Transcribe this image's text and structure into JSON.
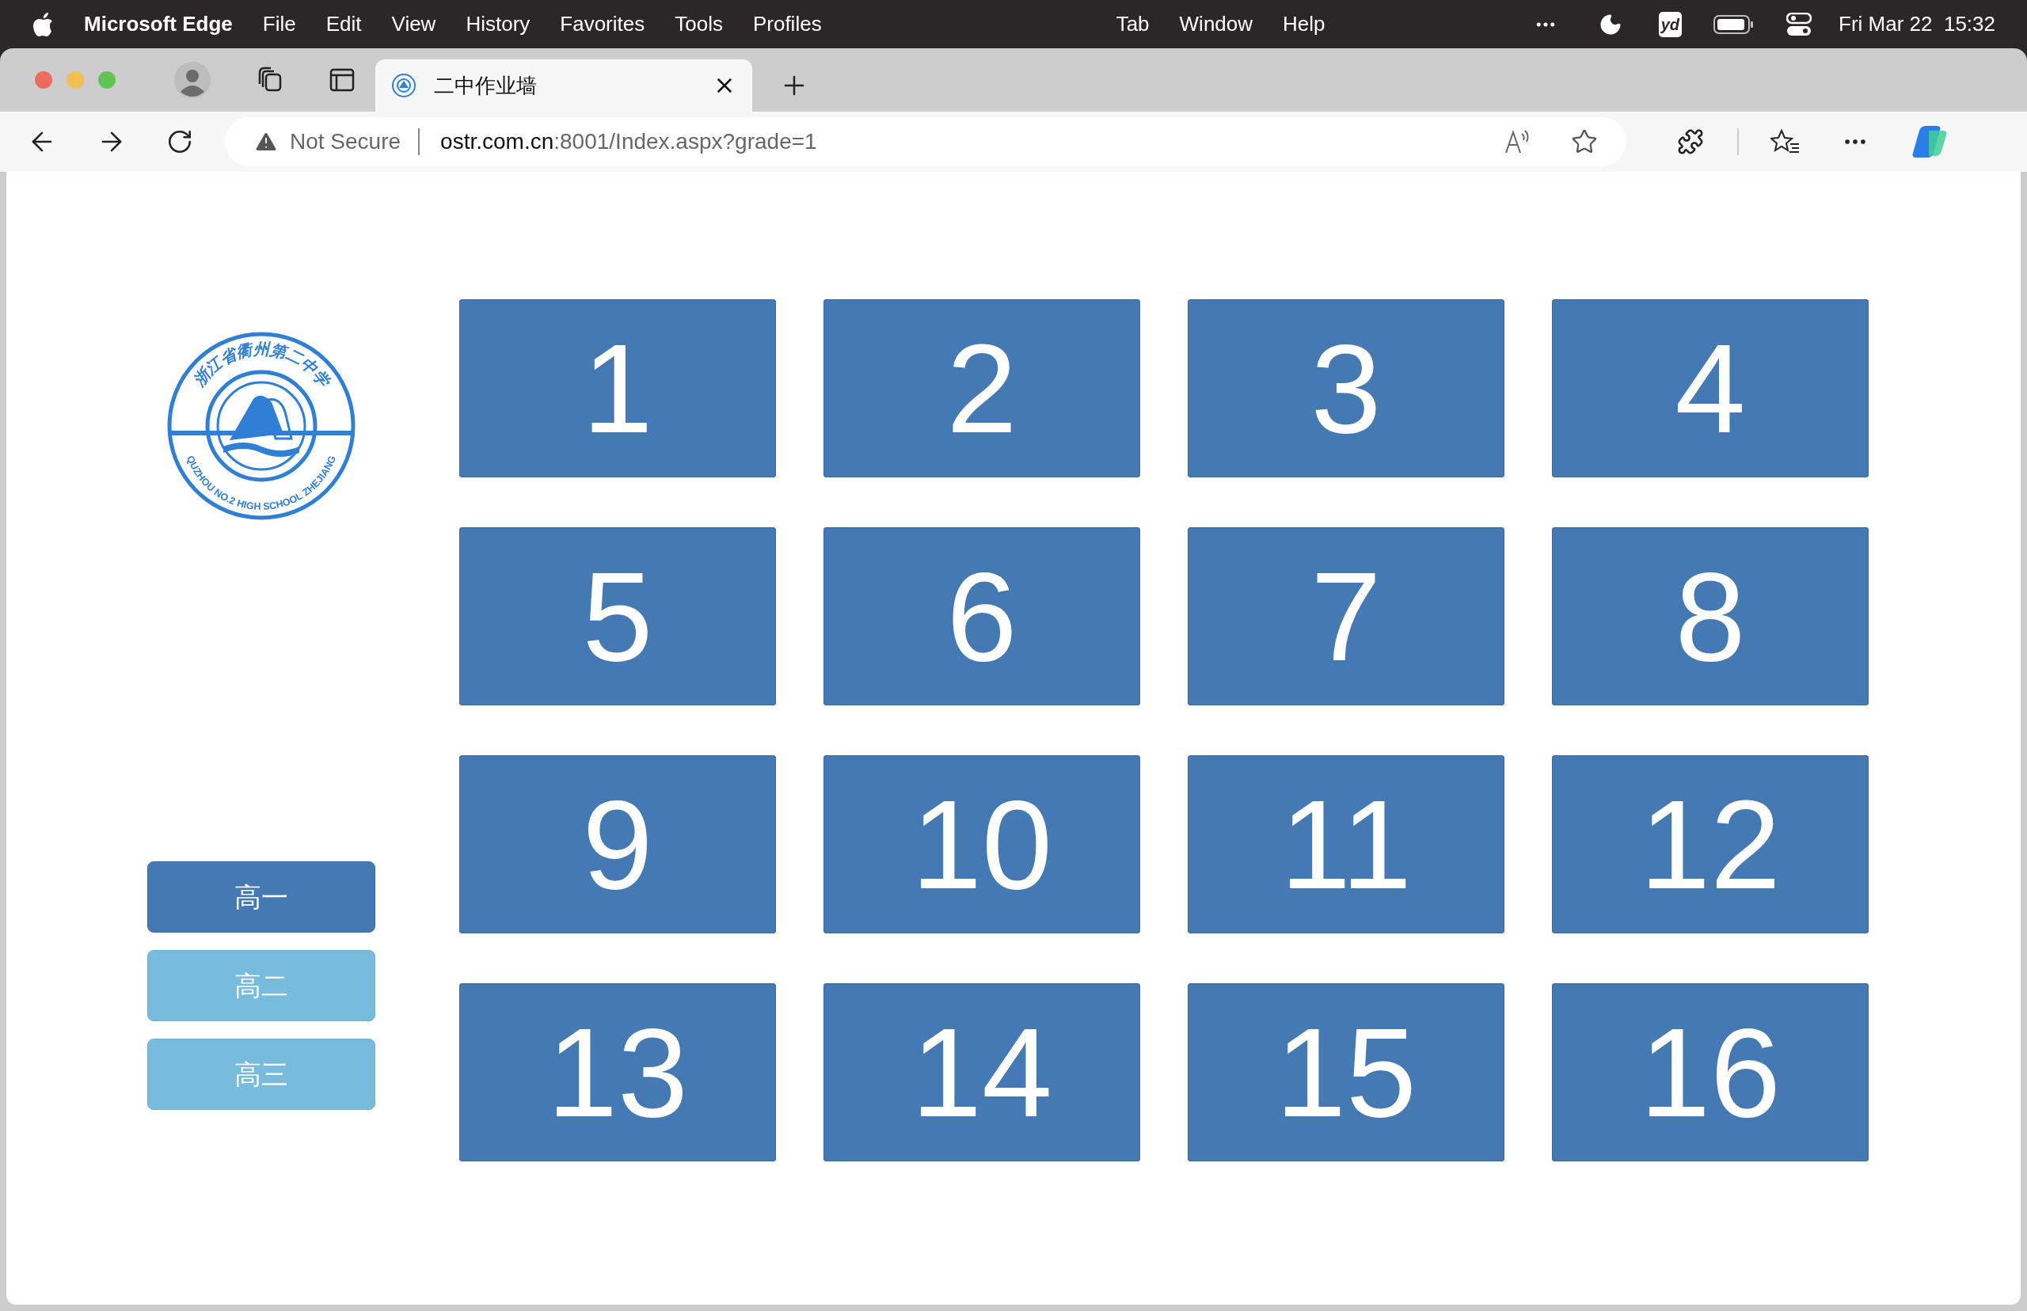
{
  "menu_bar": {
    "app": "Microsoft Edge",
    "menus": [
      "File",
      "Edit",
      "View",
      "History",
      "Favorites",
      "Tools",
      "Profiles",
      "Tab",
      "Window",
      "Help"
    ],
    "status_icon_text": "yd",
    "clock": "Fri Mar 22  15:32"
  },
  "tab": {
    "title": "二中作业墙"
  },
  "address_bar": {
    "security": "Not Secure",
    "host": "ostr.com.cn",
    "path": ":8001/Index.aspx?grade=1"
  },
  "logo": {
    "top_text": "浙江省衢州第二中学",
    "bottom_text": "QUZHOU NO.2 HIGH SCHOOL ZHEJIANG"
  },
  "grades": [
    {
      "label": "高一",
      "selected": true
    },
    {
      "label": "高二",
      "selected": false
    },
    {
      "label": "高三",
      "selected": false
    }
  ],
  "classes": [
    "1",
    "2",
    "3",
    "4",
    "5",
    "6",
    "7",
    "8",
    "9",
    "10",
    "11",
    "12",
    "13",
    "14",
    "15",
    "16"
  ]
}
